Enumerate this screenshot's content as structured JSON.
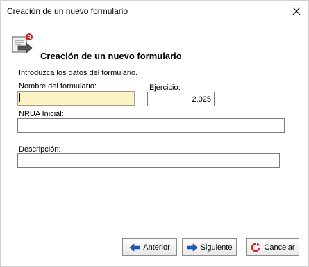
{
  "window": {
    "title": "Creación de un nuevo formulario"
  },
  "header": {
    "title": "Creación de un nuevo formulario",
    "icon": "form-export-icon"
  },
  "form": {
    "intro": "Introduzca los datos del formulario.",
    "nombre_label": "Nombre del formulario:",
    "nombre_value": "",
    "ejercicio_label": "Ejercicio:",
    "ejercicio_value": "2.025",
    "nrua_label": "NRUA Inicial:",
    "nrua_value": "",
    "descripcion_label": "Descripción:",
    "descripcion_value": ""
  },
  "buttons": {
    "anterior": "Anterior",
    "siguiente": "Siguiente",
    "cancelar": "Cancelar"
  },
  "colors": {
    "focused_field": "#fbf2c6",
    "arrow_blue": "#1f5fb8",
    "cancel_red": "#d42020"
  }
}
